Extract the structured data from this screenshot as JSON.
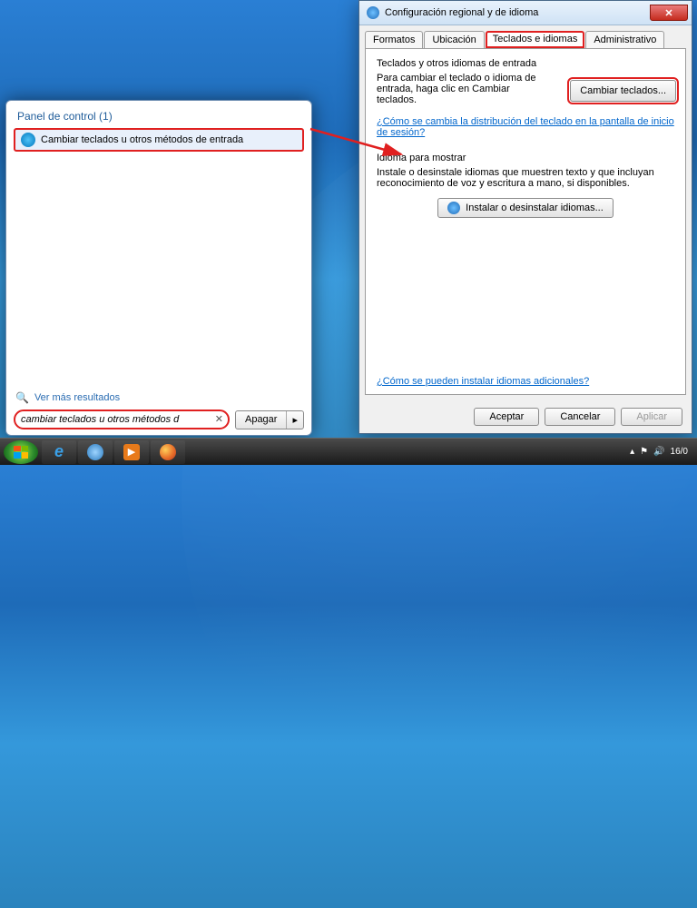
{
  "desktop": {
    "date_short": "16/0"
  },
  "start_menu": {
    "heading": "Panel de control (1)",
    "result_label": "Cambiar teclados u otros métodos de entrada",
    "see_more": "Ver más resultados",
    "search_value": "cambiar teclados u otros métodos d",
    "shutdown_label": "Apagar"
  },
  "dialog": {
    "title": "Configuración regional y de idioma",
    "tabs": {
      "formats": "Formatos",
      "location": "Ubicación",
      "keyboards": "Teclados e idiomas",
      "admin": "Administrativo"
    },
    "section1": {
      "heading": "Teclados y otros idiomas de entrada",
      "desc": "Para cambiar el teclado o idioma de entrada, haga clic en Cambiar teclados.",
      "button": "Cambiar teclados...",
      "link": "¿Cómo se cambia la distribución del teclado en la pantalla de inicio de sesión?"
    },
    "section2": {
      "heading": "Idioma para mostrar",
      "desc": "Instale o desinstale idiomas que muestren texto y que incluyan reconocimiento de voz y escritura a mano, si disponibles.",
      "button": "Instalar o desinstalar idiomas..."
    },
    "footer_link": "¿Cómo se pueden instalar idiomas adicionales?",
    "buttons": {
      "ok": "Aceptar",
      "cancel": "Cancelar",
      "apply": "Aplicar"
    }
  }
}
